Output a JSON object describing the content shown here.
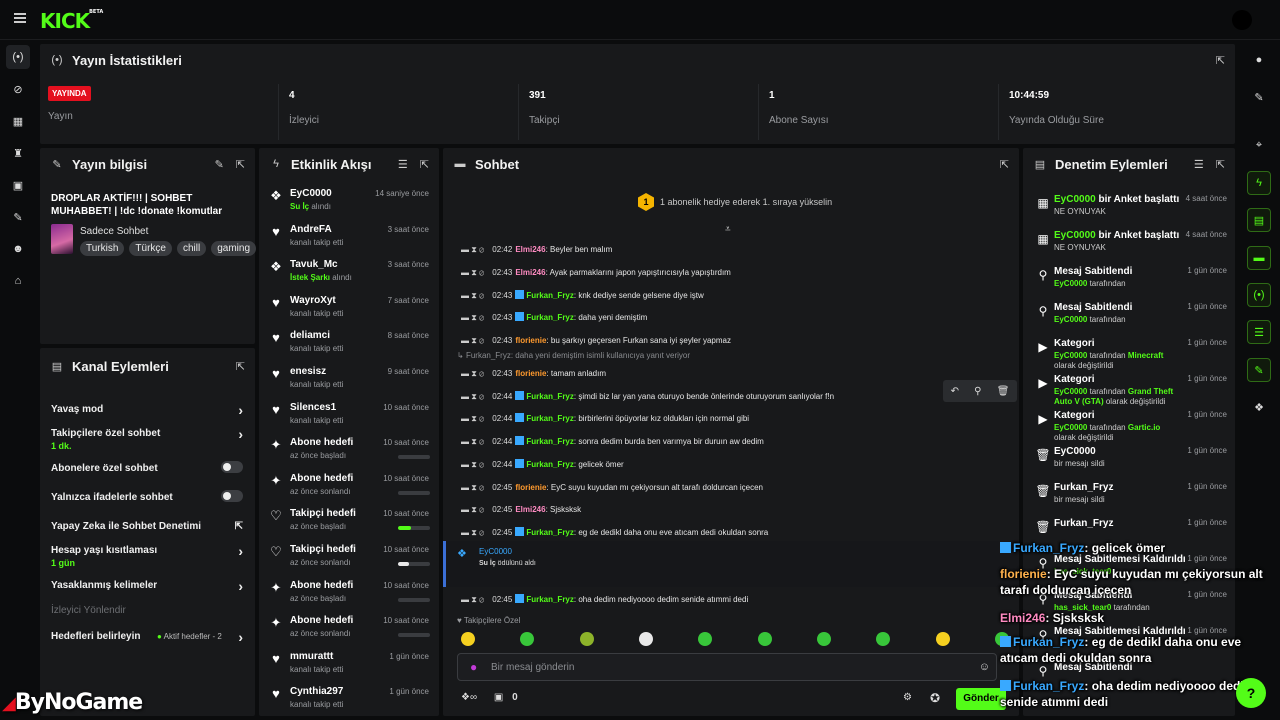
{
  "brand": {
    "name": "KICK",
    "beta": "BETA"
  },
  "stats": {
    "title": "Yayın İstatistikleri",
    "live_badge": "YAYINDA",
    "items": [
      {
        "label": "Yayın",
        "value": ""
      },
      {
        "label": "İzleyici",
        "value": "4"
      },
      {
        "label": "Takipçi",
        "value": "391"
      },
      {
        "label": "Abone Sayısı",
        "value": "1"
      },
      {
        "label": "Yayında Olduğu Süre",
        "value": "10:44:59"
      }
    ]
  },
  "stream_info": {
    "title": "Yayın bilgisi",
    "stream_title": "DROPLAR AKTİF!!! | SOHBET MUHABBET! | !dc !donate !komutlar",
    "category": "Sadece Sohbet",
    "tags": [
      "Turkish",
      "Türkçe",
      "chill",
      "gaming"
    ]
  },
  "channel_actions": {
    "title": "Kanal Eylemleri",
    "items": [
      {
        "label": "Yavaş mod",
        "sub": "",
        "control": "chevron"
      },
      {
        "label": "Takipçilere özel sohbet",
        "sub": "1 dk.",
        "control": "chevron"
      },
      {
        "label": "Abonelere özel sohbet",
        "sub": "",
        "control": "toggle"
      },
      {
        "label": "Yalnızca ifadelerle sohbet",
        "sub": "",
        "control": "toggle"
      },
      {
        "label": "Yapay Zeka ile Sohbet Denetimi",
        "sub": "",
        "control": "external"
      },
      {
        "label": "Hesap yaşı kısıtlaması",
        "sub": "1 gün",
        "control": "chevron"
      },
      {
        "label": "Yasaklanmış kelimeler",
        "sub": "",
        "control": "chevron"
      },
      {
        "label": "İzleyici Yönlendir",
        "sub": "",
        "control": "none"
      },
      {
        "label": "Hedefleri belirleyin",
        "sub": "",
        "control": "chevron",
        "extra": "Aktif hedefler - 2"
      }
    ]
  },
  "activity": {
    "title": "Etkinlik Akışı",
    "items": [
      {
        "icon": "gift-icon",
        "name": "EyC0000",
        "hl": "Su İç",
        "desc": " alındı",
        "time": "14 saniye önce",
        "progress": null
      },
      {
        "icon": "heart-icon",
        "name": "AndreFA",
        "hl": "",
        "desc": "kanalı takip etti",
        "time": "3 saat önce",
        "progress": null
      },
      {
        "icon": "gift-icon",
        "name": "Tavuk_Mc",
        "hl": "İstek Şarkı",
        "desc": " alındı",
        "time": "3 saat önce",
        "progress": null
      },
      {
        "icon": "heart-icon",
        "name": "WayroXyt",
        "hl": "",
        "desc": "kanalı takip etti",
        "time": "7 saat önce",
        "progress": null
      },
      {
        "icon": "heart-icon",
        "name": "deliamci",
        "hl": "",
        "desc": "kanalı takip etti",
        "time": "8 saat önce",
        "progress": null
      },
      {
        "icon": "heart-icon",
        "name": "enesisz",
        "hl": "",
        "desc": "kanalı takip etti",
        "time": "9 saat önce",
        "progress": null
      },
      {
        "icon": "heart-icon",
        "name": "Silences1",
        "hl": "",
        "desc": "kanalı takip etti",
        "time": "10 saat önce",
        "progress": null
      },
      {
        "icon": "sparkle-icon",
        "name": "Abone hedefi",
        "hl": "",
        "desc": "az önce başladı",
        "time": "10 saat önce",
        "progress": 0.0
      },
      {
        "icon": "sparkle-icon",
        "name": "Abone hedefi",
        "hl": "",
        "desc": "az önce sonlandı",
        "time": "10 saat önce",
        "progress": 0.0
      },
      {
        "icon": "heart-outline-icon",
        "name": "Takipçi hedefi",
        "hl": "",
        "desc": "az önce başladı",
        "time": "10 saat önce",
        "progress": 0.4
      },
      {
        "icon": "heart-outline-icon",
        "name": "Takipçi hedefi",
        "hl": "",
        "desc": "az önce sonlandı",
        "time": "10 saat önce",
        "progress": 0.35
      },
      {
        "icon": "sparkle-icon",
        "name": "Abone hedefi",
        "hl": "",
        "desc": "az önce başladı",
        "time": "10 saat önce",
        "progress": 0.0
      },
      {
        "icon": "sparkle-icon",
        "name": "Abone hedefi",
        "hl": "",
        "desc": "az önce sonlandı",
        "time": "10 saat önce",
        "progress": 0.0
      },
      {
        "icon": "heart-icon",
        "name": "mmurattt",
        "hl": "",
        "desc": "kanalı takip etti",
        "time": "1 gün önce",
        "progress": null
      },
      {
        "icon": "heart-icon",
        "name": "Cynthia297",
        "hl": "",
        "desc": "kanalı takip etti",
        "time": "1 gün önce",
        "progress": null
      }
    ]
  },
  "chat": {
    "title": "Sohbet",
    "pinned_badge": "1",
    "pinned_text": "1 abonelik hediye ederek 1. sıraya yükselin",
    "reply_context": "Furkan_Fryz: daha yeni demiştim isimli kullanıcıya yanıt veriyor",
    "messages": [
      {
        "time": "02:42",
        "user": "Elmi246",
        "color": "#ff8bc2",
        "kick": false,
        "text": ": Beyler ben malım"
      },
      {
        "time": "02:43",
        "user": "Elmi246",
        "color": "#ff8bc2",
        "kick": false,
        "text": ": Ayak parmaklarını japon yapıştırıcısıyla yapıştırdım"
      },
      {
        "time": "02:43",
        "user": "Furkan_Fryz",
        "color": "#53fc18",
        "kick": true,
        "text": ": knk dediye sende gelsene diye iştw"
      },
      {
        "time": "02:43",
        "user": "Furkan_Fryz",
        "color": "#53fc18",
        "kick": true,
        "text": ": daha yeni demiştim"
      },
      {
        "time": "02:43",
        "user": "florienie",
        "color": "#ff9a2e",
        "kick": false,
        "text": ": bu şarkıyı geçersen Furkan sana iyi şeyler yapmaz"
      },
      {
        "time": "02:43",
        "user": "florienie",
        "color": "#ff9a2e",
        "kick": false,
        "text": ": tamam anladım"
      },
      {
        "time": "02:44",
        "user": "Furkan_Fryz",
        "color": "#53fc18",
        "kick": true,
        "text": ": şimdi biz lar yan yana oturuyo bende önlerinde oturuyorum sanlıyolar f!n"
      },
      {
        "time": "02:44",
        "user": "Furkan_Fryz",
        "color": "#53fc18",
        "kick": true,
        "text": ": birbirlerini öpüyorlar kız oldukları için normal gibi"
      },
      {
        "time": "02:44",
        "user": "Furkan_Fryz",
        "color": "#53fc18",
        "kick": true,
        "text": ": sonra dedim burda ben varımya bir duruın aw dedim"
      },
      {
        "time": "02:44",
        "user": "Furkan_Fryz",
        "color": "#53fc18",
        "kick": true,
        "text": ": gelicek ömer"
      },
      {
        "time": "02:45",
        "user": "florienie",
        "color": "#ff9a2e",
        "kick": false,
        "text": ": EyC suyu kuyudan mı çekiyorsun alt tarafı doldurcan içecen"
      },
      {
        "time": "02:45",
        "user": "Elmi246",
        "color": "#ff8bc2",
        "kick": false,
        "text": ": Sjsksksk"
      },
      {
        "time": "02:45",
        "user": "Furkan_Fryz",
        "color": "#53fc18",
        "kick": true,
        "text": ": eg de dedikl daha onu eve atıcam dedi okuldan sonra"
      }
    ],
    "reward": {
      "user": "EyC0000",
      "reward": "Su İç",
      "text": " ödülünü aldı"
    },
    "last_message": {
      "time": "02:45",
      "user": "Furkan_Fryz",
      "text": ": oha dedim nediyoooo dedim senide atımmi dedi"
    },
    "followers_only": "Takipçilere Özel",
    "input_placeholder": "Bir mesaj gönderin",
    "points": "0",
    "send_label": "Gönder"
  },
  "audit": {
    "title": "Denetim Eylemleri",
    "items": [
      {
        "icon": "chart-icon",
        "actor": "EyC0000",
        "action": " bir Anket başlattı",
        "detail": "NE OYNUYAK",
        "time": "4 saat önce"
      },
      {
        "icon": "chart-icon",
        "actor": "EyC0000",
        "action": " bir Anket başlattı",
        "detail": "NE OYNUYAK",
        "time": "4 saat önce"
      },
      {
        "icon": "pin-icon",
        "actor": "",
        "action": "Mesaj Sabitlendi",
        "detail_user": "EyC0000",
        "detail": " tarafından",
        "time": "1 gün önce"
      },
      {
        "icon": "pin-icon",
        "actor": "",
        "action": "Mesaj Sabitlendi",
        "detail_user": "EyC0000",
        "detail": " tarafından",
        "time": "1 gün önce"
      },
      {
        "icon": "category-icon",
        "actor": "",
        "action": "Kategori",
        "detail_user": "EyC0000",
        "detail": " tarafından ",
        "detail_hl": "Minecraft",
        "detail_tail": " olarak değiştirildi",
        "time": "1 gün önce"
      },
      {
        "icon": "category-icon",
        "actor": "",
        "action": "Kategori",
        "detail_user": "EyC0000",
        "detail": " tarafından ",
        "detail_hl": "Grand Theft Auto V (GTA)",
        "detail_tail": " olarak değiştirildi",
        "time": "1 gün önce"
      },
      {
        "icon": "category-icon",
        "actor": "",
        "action": "Kategori",
        "detail_user": "EyC0000",
        "detail": " tarafından ",
        "detail_hl": "Gartic.io",
        "detail_tail": " olarak değiştirildi",
        "time": "1 gün önce"
      },
      {
        "icon": "trash-icon",
        "actor": "",
        "action": "EyC0000",
        "detail": "bir mesajı sildi",
        "time": "1 gün önce"
      },
      {
        "icon": "trash-icon",
        "actor": "",
        "action": "Furkan_Fryz",
        "detail": "bir mesajı sildi",
        "time": "1 gün önce"
      },
      {
        "icon": "trash-icon",
        "actor": "",
        "action": "Furkan_Fryz",
        "detail": "",
        "time": "1 gün önce"
      },
      {
        "icon": "pin-icon",
        "actor": "",
        "action": "Mesaj Sabitlemesi Kaldırıldı",
        "detail_user": "has_sick_tear0",
        "detail": "",
        "time": "1 gün önce"
      },
      {
        "icon": "pin-icon",
        "actor": "",
        "action": "Mesaj Sabitlendi",
        "detail_user": "has_sick_tear0",
        "detail": " tarafından",
        "time": "1 gün önce"
      },
      {
        "icon": "pin-icon",
        "actor": "",
        "action": "Mesaj Sabitlemesi Kaldırıldı",
        "detail_user": "",
        "detail": "",
        "time": "1 gün önce"
      },
      {
        "icon": "pin-icon",
        "actor": "",
        "action": "Mesaj Sabitlendi",
        "detail_user": "",
        "detail": "",
        "time": ""
      }
    ]
  },
  "overlay": {
    "lines": [
      {
        "user": "Furkan_Fryz",
        "color": "#39a9ff",
        "kick": true,
        "text": ": gelicek ömer"
      },
      {
        "user": "florienie",
        "color": "#ffb24d",
        "kick": false,
        "text": ": EyC suyu kuyudan mı çekiyorsun alt tarafı doldurcan içecen"
      },
      {
        "user": "Elmi246",
        "color": "#ff8bc2",
        "kick": false,
        "text": ": Sjsksksk"
      },
      {
        "user": "Furkan_Fryz",
        "color": "#39a9ff",
        "kick": true,
        "text": ": eg de dedikl daha onu eve atıcam dedi okuldan sonra"
      },
      {
        "user": "Furkan_Fryz",
        "color": "#39a9ff",
        "kick": true,
        "text": ": oha dedim nediyoooo dedim senide atımmi dedi"
      }
    ]
  },
  "watermark": "ByNoGame",
  "colors": {
    "accent": "#53fc18",
    "live": "#e4101f",
    "panel": "#18191b"
  }
}
